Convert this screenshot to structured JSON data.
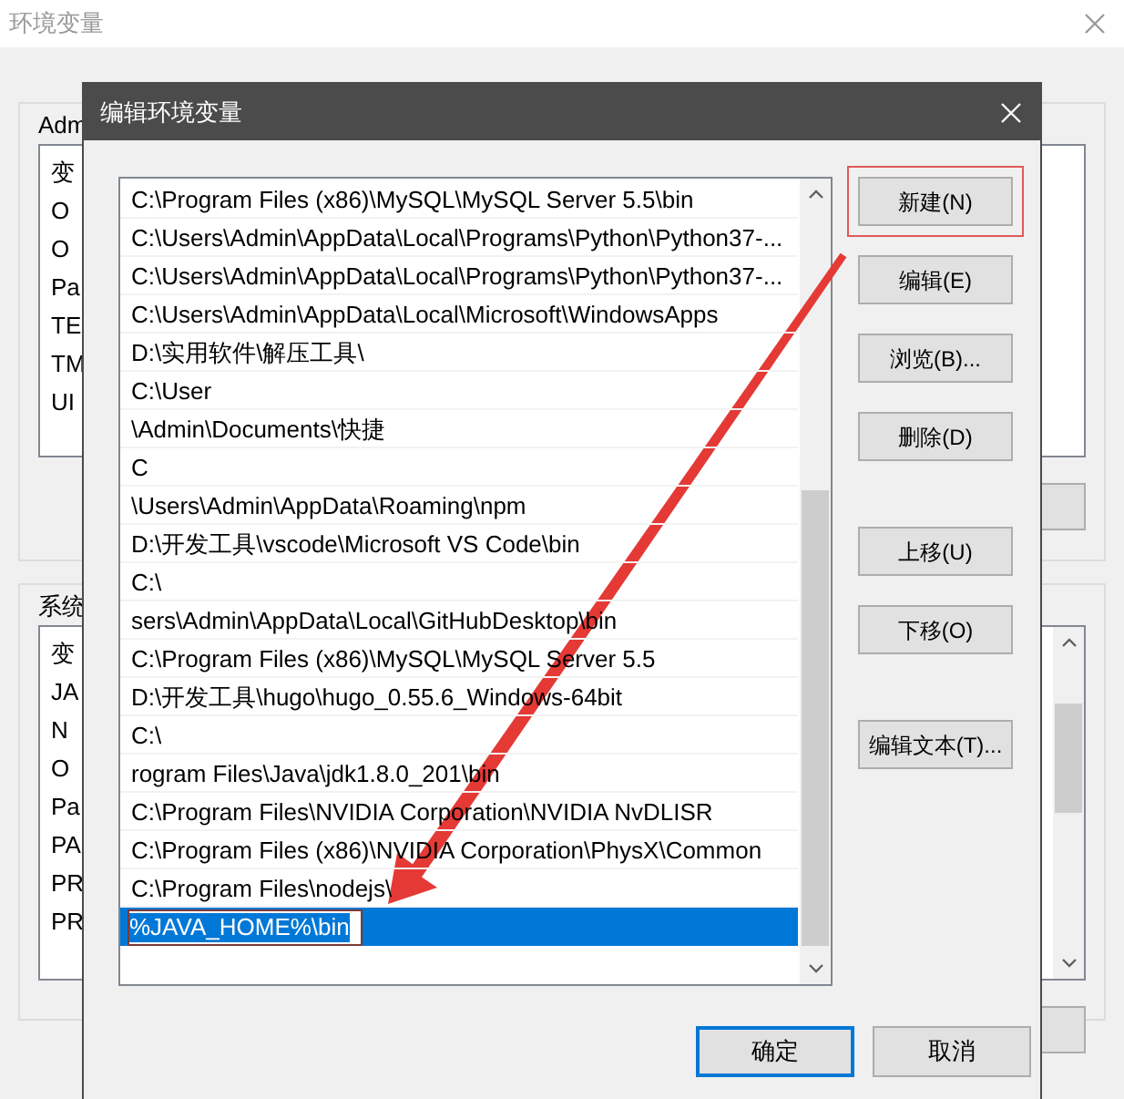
{
  "window": {
    "title": "环境变量"
  },
  "user_group": {
    "label": "Adm",
    "rows": [
      "变",
      "O",
      "O",
      "Pa",
      "TE",
      "TM",
      "UI"
    ]
  },
  "system_group": {
    "label": "系统",
    "rows": [
      "变",
      "JA",
      "N",
      "O",
      "Pa",
      "PA",
      "PR",
      "PR"
    ]
  },
  "dialog": {
    "title": "编辑环境变量",
    "paths": [
      {
        "kind": "text",
        "text": "C:\\Program Files (x86)\\MySQL\\MySQL Server 5.5\\bin",
        "selected": false
      },
      {
        "kind": "text",
        "text": "C:\\Users\\Admin\\AppData\\Local\\Programs\\Python\\Python37-...",
        "selected": false
      },
      {
        "kind": "text",
        "text": "C:\\Users\\Admin\\AppData\\Local\\Programs\\Python\\Python37-...",
        "selected": false
      },
      {
        "kind": "text",
        "text": "C:\\Users\\Admin\\AppData\\Local\\Microsoft\\WindowsApps",
        "selected": false
      },
      {
        "kind": "text",
        "text": "D:\\实用软件\\解压工具\\",
        "selected": false
      },
      {
        "kind": "text",
        "text": "C:\\User",
        "selected": false
      },
      {
        "kind": "text",
        "text": "\\Admin\\Documents\\快捷",
        "selected": false
      },
      {
        "kind": "text",
        "text": "C",
        "selected": false
      },
      {
        "kind": "text",
        "text": "\\Users\\Admin\\AppData\\Roaming\\npm",
        "selected": false
      },
      {
        "kind": "text",
        "text": "D:\\开发工具\\vscode\\Microsoft VS Code\\bin",
        "selected": false
      },
      {
        "kind": "text",
        "text": "C:\\",
        "selected": false
      },
      {
        "kind": "text",
        "text": "sers\\Admin\\AppData\\Local\\GitHubDesktop\\bin",
        "selected": false
      },
      {
        "kind": "text",
        "text": "C:\\Program Files (x86)\\MySQL\\MySQL Server 5.5",
        "selected": false
      },
      {
        "kind": "text",
        "text": "D:\\开发工具\\hugo\\hugo_0.55.6_Windows-64bit",
        "selected": false
      },
      {
        "kind": "text",
        "text": "C:\\",
        "selected": false
      },
      {
        "kind": "text",
        "text": "rogram Files\\Java\\jdk1.8.0_201\\bin",
        "selected": false
      },
      {
        "kind": "text",
        "text": "C:\\Program Files\\NVIDIA Corporation\\NVIDIA NvDLISR",
        "selected": false
      },
      {
        "kind": "text",
        "text": "C:\\Program Files (x86)\\NVIDIA Corporation\\PhysX\\Common",
        "selected": false
      },
      {
        "kind": "text",
        "text": "C:\\Program Files\\nodejs\\",
        "selected": false
      },
      {
        "kind": "editing",
        "text": "%JAVA_HOME%\\bin",
        "selected": true
      }
    ],
    "button_groups": [
      [
        {
          "label": "新建(N)",
          "highlighted": true
        },
        {
          "label": "编辑(E)",
          "highlighted": false
        },
        {
          "label": "浏览(B)...",
          "highlighted": false
        },
        {
          "label": "删除(D)",
          "highlighted": false
        }
      ],
      [
        {
          "label": "上移(U)",
          "highlighted": false
        },
        {
          "label": "下移(O)",
          "highlighted": false
        }
      ],
      [
        {
          "label": "编辑文本(T)...",
          "highlighted": false
        }
      ]
    ],
    "footer": [
      {
        "label": "确定",
        "default": true
      },
      {
        "label": "取消",
        "default": false
      }
    ]
  }
}
